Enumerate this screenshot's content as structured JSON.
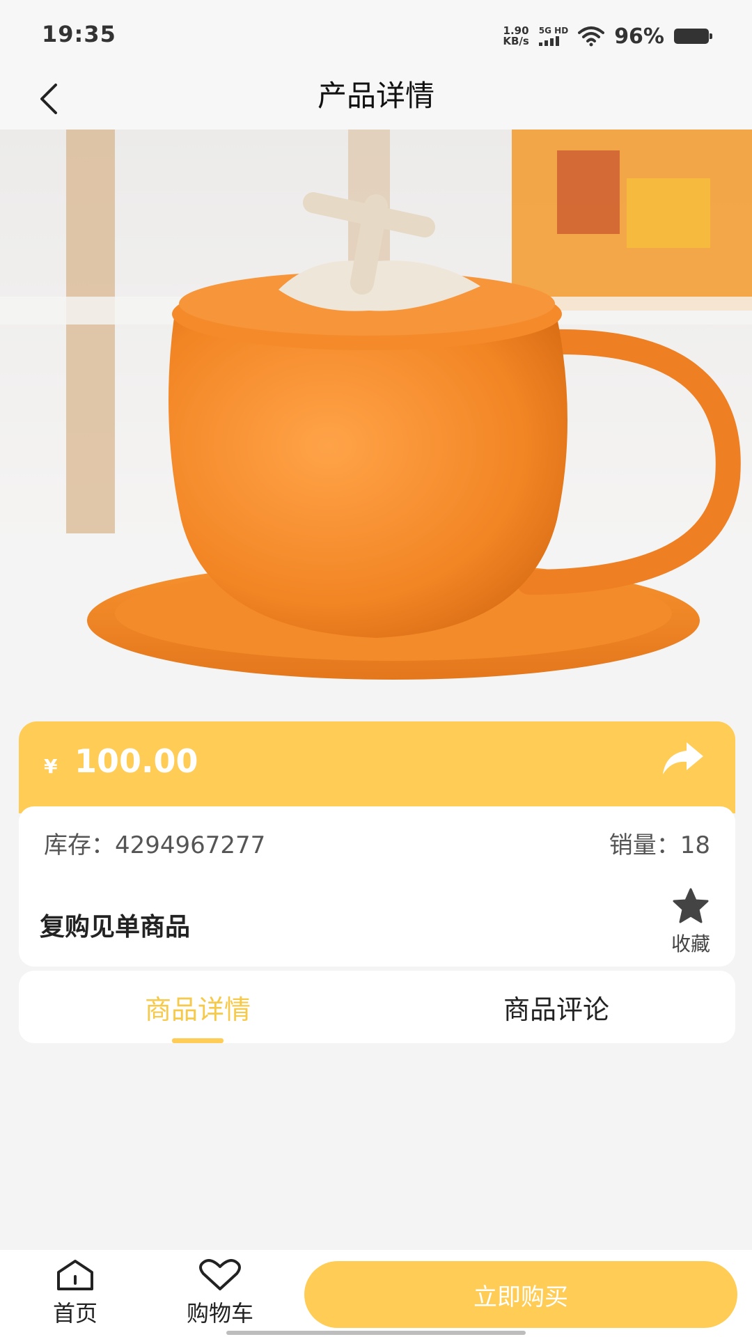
{
  "status_bar": {
    "time": "19:35",
    "net_speed_value": "1.90",
    "net_speed_unit": "KB/s",
    "network_type": "5G HD",
    "battery_percent": "96%"
  },
  "nav": {
    "title": "产品详情",
    "back_icon": "chevron-left-icon"
  },
  "product": {
    "image_subject": "orange-persimmon-tea-cup",
    "currency_symbol": "¥",
    "price": "100.00",
    "stock_label": "库存：",
    "stock_value": "4294967277",
    "sales_label": "销量：",
    "sales_value": "18",
    "name": "复购见单商品",
    "favorite_label": "收藏",
    "favorite_icon": "star-icon",
    "share_icon": "share-arrow-icon"
  },
  "tabs": [
    {
      "label": "商品详情",
      "active": true
    },
    {
      "label": "商品评论",
      "active": false
    }
  ],
  "bottom_bar": {
    "home_label": "首页",
    "home_icon": "home-icon",
    "cart_label": "购物车",
    "cart_icon": "heart-icon",
    "buy_label": "立即购买"
  },
  "colors": {
    "accent": "#ffcc55",
    "active_tab_text": "#f7c948",
    "background": "#f4f4f5"
  }
}
